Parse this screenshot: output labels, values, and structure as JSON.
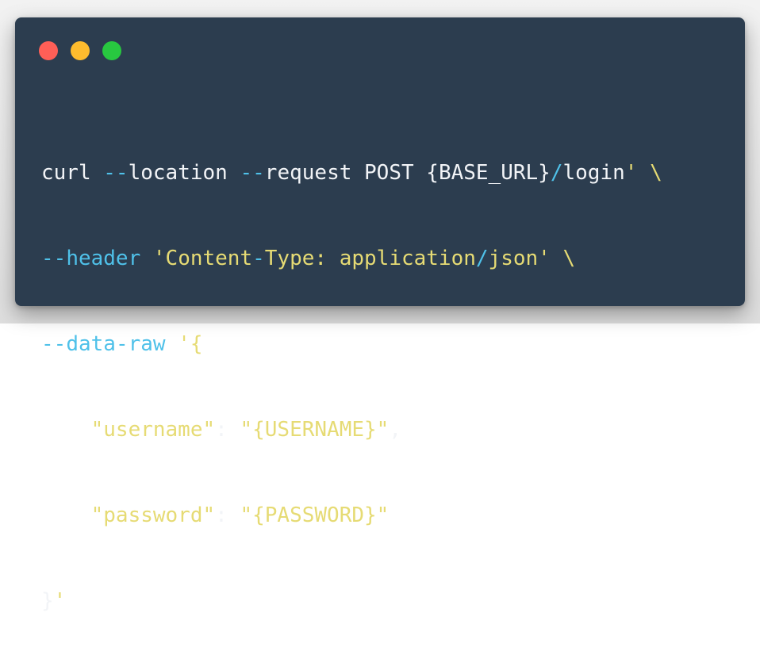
{
  "window": {
    "controls": [
      "close",
      "minimize",
      "zoom"
    ],
    "colors": {
      "background": "#2c3d4f",
      "close": "#ff5f57",
      "minimize": "#febc2e",
      "zoom": "#28c840",
      "text": "#f2f4f7",
      "flag": "#4fc1e9",
      "string": "#e6db74"
    }
  },
  "code": {
    "line1": {
      "t1": "curl ",
      "t2": "--",
      "t3": "location ",
      "t4": "--",
      "t5": "request POST {BASE_URL}",
      "t6": "/",
      "t7": "login",
      "t8": "'",
      "t9": " \\"
    },
    "line2": {
      "t1": "--",
      "t2": "header",
      "t3": " 'Content",
      "t4": "-",
      "t5": "Type: application",
      "t6": "/",
      "t7": "json'",
      "t8": " \\"
    },
    "line3": {
      "t1": "--",
      "t2": "data",
      "t3": "-",
      "t4": "raw",
      "t5": " '{"
    },
    "line4": {
      "t1": "    \"username\"",
      "t2": ": ",
      "t3": "\"{USERNAME}\"",
      "t4": ","
    },
    "line5": {
      "t1": "    \"password\"",
      "t2": ": ",
      "t3": "\"{PASSWORD}\""
    },
    "line6": {
      "t1": "}",
      "t2": "'"
    }
  }
}
